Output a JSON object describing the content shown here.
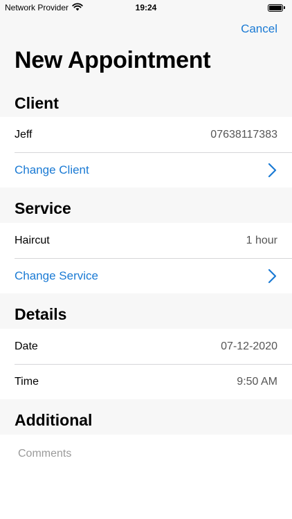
{
  "status_bar": {
    "carrier": "Network Provider",
    "time": "19:24",
    "icons": {
      "wifi": "wifi-icon",
      "battery": "battery-icon"
    }
  },
  "nav": {
    "cancel_label": "Cancel"
  },
  "title": "New Appointment",
  "client": {
    "header": "Client",
    "name": "Jeff",
    "phone": "07638117383",
    "change_label": "Change Client"
  },
  "service": {
    "header": "Service",
    "name": "Haircut",
    "duration": "1 hour",
    "change_label": "Change Service"
  },
  "details": {
    "header": "Details",
    "date_label": "Date",
    "date_value": "07-12-2020",
    "time_label": "Time",
    "time_value": "9:50 AM"
  },
  "additional": {
    "header": "Additional",
    "comments_placeholder": "Comments"
  },
  "colors": {
    "accent": "#1a7ad4",
    "background": "#f7f7f7",
    "separator": "#d6d6d8"
  }
}
